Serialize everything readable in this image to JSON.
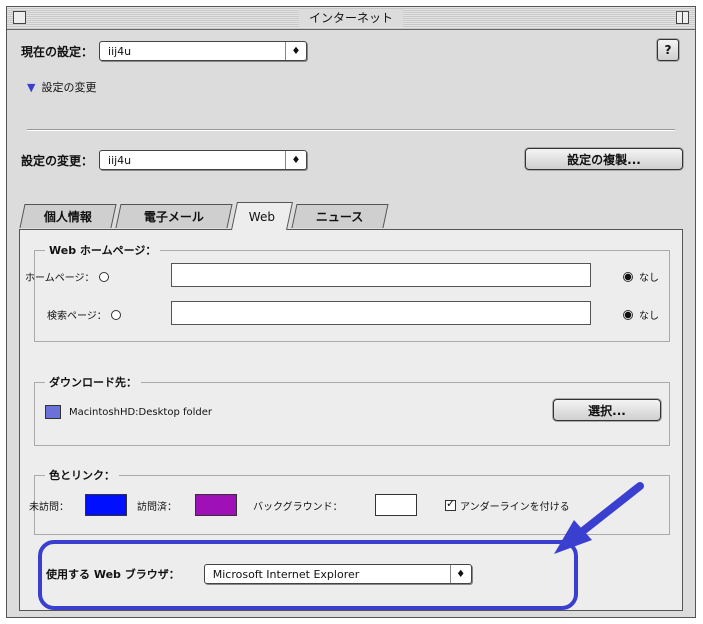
{
  "window": {
    "title": "インターネット"
  },
  "current_setting": {
    "label": "現在の設定：",
    "value": "iij4u"
  },
  "disclosure": {
    "label": "設定の変更"
  },
  "help": {
    "icon": "help-icon",
    "glyph": "?"
  },
  "change_setting": {
    "label": "設定の変更：",
    "value": "iij4u"
  },
  "duplicate_button": {
    "label": "設定の複製..."
  },
  "tabs": [
    {
      "label": "個人情報"
    },
    {
      "label": "電子メール"
    },
    {
      "label": "Web"
    },
    {
      "label": "ニュース"
    }
  ],
  "web_home": {
    "title": "Web ホームページ：",
    "home_label": "ホームページ：",
    "home_value": "",
    "search_label": "検索ページ：",
    "search_value": "",
    "home_none": "なし",
    "search_none": "なし"
  },
  "download": {
    "title": "ダウンロード先：",
    "path": "MacintoshHD:Desktop folder",
    "select_button": "選択..."
  },
  "colors_links": {
    "title": "色とリンク：",
    "unvisited_label": "未訪問：",
    "unvisited_color": "#0010ff",
    "visited_label": "訪問済：",
    "visited_color": "#a010b8",
    "background_label": "バックグラウンド：",
    "background_color": "#ffffff",
    "underline_label": "アンダーラインを付ける"
  },
  "browser": {
    "label": "使用する Web ブラウザ：",
    "value": "Microsoft Internet Explorer"
  },
  "annotation": {
    "color": "#3a3fd0"
  }
}
